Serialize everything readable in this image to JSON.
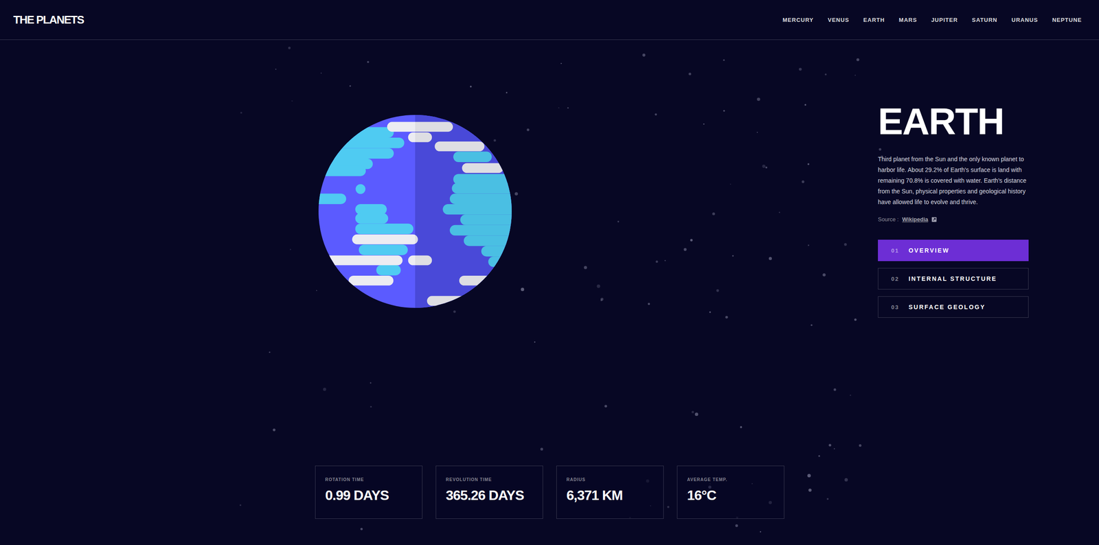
{
  "logo": "THE PLANETS",
  "nav": [
    "MERCURY",
    "VENUS",
    "EARTH",
    "MARS",
    "JUPITER",
    "SATURN",
    "URANUS",
    "NEPTUNE"
  ],
  "planet": {
    "name": "EARTH",
    "description": "Third planet from the Sun and the only known planet to harbor life. About 29.2% of Earth's surface is land with remaining 70.8% is covered with water. Earth's distance from the Sun, physical properties and geological history have allowed life to evolve and thrive.",
    "source_label": "Source :",
    "source_link": "Wikipedia"
  },
  "tabs": [
    {
      "number": "01",
      "label": "OVERVIEW",
      "selected": true
    },
    {
      "number": "02",
      "label": "INTERNAL STRUCTURE",
      "selected": false
    },
    {
      "number": "03",
      "label": "SURFACE GEOLOGY",
      "selected": false
    }
  ],
  "stats": [
    {
      "label": "ROTATION TIME",
      "value": "0.99 DAYS"
    },
    {
      "label": "REVOLUTION TIME",
      "value": "365.26 DAYS"
    },
    {
      "label": "RADIUS",
      "value": "6,371 KM"
    },
    {
      "label": "AVERAGE TEMP.",
      "value": "16°C"
    }
  ]
}
